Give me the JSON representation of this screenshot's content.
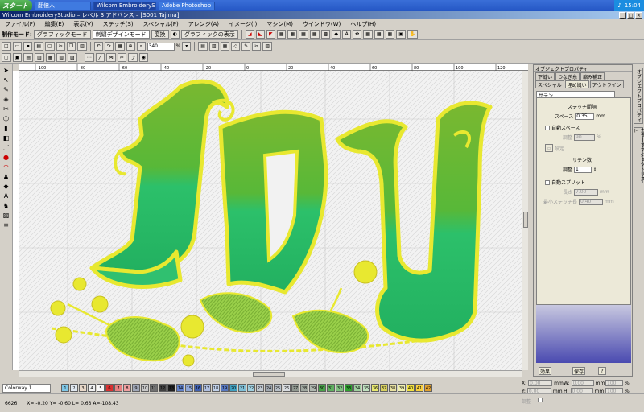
{
  "taskbar": {
    "start": "スタート",
    "items": [
      "翻億人",
      "Wilcom EmbroideryS...",
      "Adobe Photoshop"
    ],
    "time": "15:04"
  },
  "window": {
    "title": "Wilcom EmbroideryStudio – レベル 3 アドバンス – [S001     Tajima]"
  },
  "menu": [
    "ファイル(F)",
    "編集(E)",
    "表示(V)",
    "ステッチ(S)",
    "スペシャル(P)",
    "アレンジ(A)",
    "イメージ(I)",
    "マシン(M)",
    "ウインドウ(W)",
    "ヘルプ(H)"
  ],
  "toolbar1": {
    "mode_label": "制作モード:",
    "graphic_mode": "グラフィックモード",
    "design_mode": "刺繍デザインモード",
    "convert": "変換",
    "show_graphic": "グラフィックの表示"
  },
  "toolbar2": {
    "zoom": "340",
    "zoom_unit": "%"
  },
  "ruler": {
    "ticks": [
      "-100",
      "-80",
      "-60",
      "-40",
      "-20",
      "0",
      "20",
      "40",
      "60",
      "80",
      "100",
      "120"
    ]
  },
  "panel": {
    "title": "オブジェクトプロパティ",
    "tabs": [
      "下縫い",
      "つなぎ糸",
      "縮み補正",
      "スペシャル",
      "埋め縫い",
      "アウトライン"
    ],
    "fill_type": "サテン",
    "stitch_spacing_label": "ステッチ間隔",
    "space_label": "スペース",
    "space_value": "0.35",
    "space_unit": "mm",
    "auto_space_label": "自動スペース",
    "adjust_label": "調整",
    "adjust_value": "90",
    "adjust_unit": "%",
    "setting_label": "設定...",
    "satin_section": "サテン数",
    "satin_adjust_label": "調整",
    "satin_adjust_value": "1",
    "auto_split_label": "自動スプリット",
    "length_label": "長さ",
    "length_value": "7.00",
    "length_unit": "mm",
    "min_stitch_label": "最小ステッチ長",
    "min_stitch_value": "0.40",
    "min_stitch_unit": "mm",
    "apply_button": "効果",
    "save_button": "保存",
    "help_button": "?",
    "side_tabs": [
      "オブジェクトプロパティ",
      "カラーオブジェクトリスト"
    ]
  },
  "colorbar": {
    "colorway": "Colorway 1",
    "swatches": [
      {
        "n": "1",
        "c": "#7fc8e8"
      },
      {
        "n": "2",
        "c": "#e0e8f0"
      },
      {
        "n": "3",
        "c": "#e8d8c8"
      },
      {
        "n": "4",
        "c": "#f0f0f0"
      },
      {
        "n": "5",
        "c": "#f8f8f8"
      },
      {
        "n": "6",
        "c": "#d83030"
      },
      {
        "n": "7",
        "c": "#e88080"
      },
      {
        "n": "8",
        "c": "#f0a0a0"
      },
      {
        "n": "9",
        "c": "#a0a8b8"
      },
      {
        "n": "10",
        "c": "#c8c8c8"
      },
      {
        "n": "11",
        "c": "#707070"
      },
      {
        "n": "12",
        "c": "#404040"
      },
      {
        "n": "13",
        "c": "#202020"
      },
      {
        "n": "14",
        "c": "#6080c8"
      },
      {
        "n": "15",
        "c": "#90a8d8"
      },
      {
        "n": "16",
        "c": "#4060b0"
      },
      {
        "n": "17",
        "c": "#b0c0e0"
      },
      {
        "n": "18",
        "c": "#c0d0e8"
      },
      {
        "n": "19",
        "c": "#5878c0"
      },
      {
        "n": "20",
        "c": "#40a0c0"
      },
      {
        "n": "21",
        "c": "#80c0d8"
      },
      {
        "n": "22",
        "c": "#a0d0e0"
      },
      {
        "n": "23",
        "c": "#c0c8d0"
      },
      {
        "n": "24",
        "c": "#a0a8b0"
      },
      {
        "n": "25",
        "c": "#b8c0c8"
      },
      {
        "n": "26",
        "c": "#d8dce0"
      },
      {
        "n": "27",
        "c": "#909890"
      },
      {
        "n": "28",
        "c": "#a0a8a0"
      },
      {
        "n": "29",
        "c": "#b0b8b0"
      },
      {
        "n": "30",
        "c": "#48a048"
      },
      {
        "n": "31",
        "c": "#60b060"
      },
      {
        "n": "32",
        "c": "#80c080"
      },
      {
        "n": "33",
        "c": "#30a030"
      },
      {
        "n": "34",
        "c": "#a0d0a0"
      },
      {
        "n": "35",
        "c": "#c0e0c0"
      },
      {
        "n": "36",
        "c": "#e8e870"
      },
      {
        "n": "37",
        "c": "#d8d060"
      },
      {
        "n": "38",
        "c": "#e8e0a0"
      },
      {
        "n": "39",
        "c": "#f0f0b0"
      },
      {
        "n": "40",
        "c": "#f0e040"
      },
      {
        "n": "41",
        "c": "#f8d040"
      },
      {
        "n": "42",
        "c": "#e0a030"
      }
    ]
  },
  "status": {
    "left": "6626",
    "coords": "X= -0.20  Y= -0.60  L= 0.63  A=-108.43"
  },
  "coords_panel": {
    "x_label": "X:",
    "x_value": "0.00",
    "x_unit": "mm",
    "y_label": "Y:",
    "y_value": "0.00",
    "y_unit": "mm",
    "w_label": "W:",
    "w_value": "0.00",
    "w_unit": "mm",
    "h_label": "H:",
    "h_value": "0.00",
    "h_unit": "mm",
    "pw_value": "100",
    "pw_unit": "%",
    "ph_value": "100",
    "ph_unit": "%",
    "fix_label": "調整"
  },
  "colors": {
    "satin_green": "#3cc86e",
    "dark_green": "#2a9a4a",
    "outline_yellow": "#e8e830",
    "leaf_green": "#9ad04a"
  }
}
